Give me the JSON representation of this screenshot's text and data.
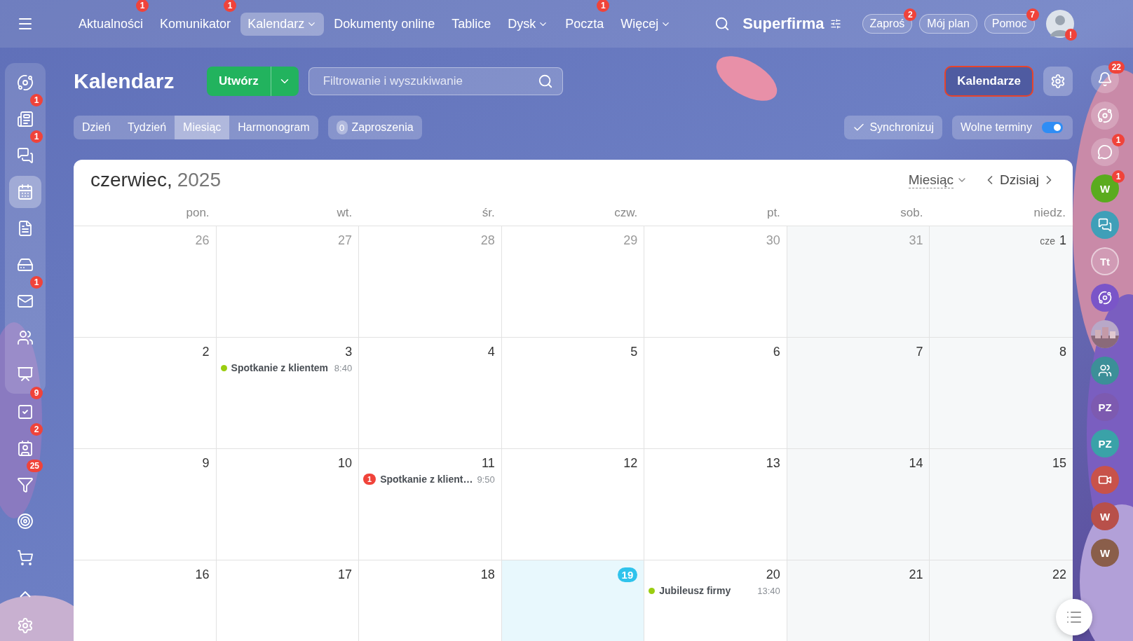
{
  "top_bar": {
    "nav": [
      {
        "label": "Aktualności",
        "badge": "1",
        "dropdown": false,
        "selected": false
      },
      {
        "label": "Komunikator",
        "badge": "1",
        "dropdown": false,
        "selected": false
      },
      {
        "label": "Kalendarz",
        "dropdown": true,
        "selected": true
      },
      {
        "label": "Dokumenty online",
        "dropdown": false,
        "selected": false
      },
      {
        "label": "Tablice",
        "dropdown": false,
        "selected": false
      },
      {
        "label": "Dysk",
        "dropdown": true,
        "selected": false
      },
      {
        "label": "Poczta",
        "badge": "1",
        "dropdown": false,
        "selected": false
      },
      {
        "label": "Więcej",
        "dropdown": true,
        "selected": false
      }
    ],
    "company": "Superfirma",
    "actions": [
      {
        "label": "Zaproś",
        "badge": "2"
      },
      {
        "label": "Mój plan"
      },
      {
        "label": "Pomoc",
        "badge": "7"
      }
    ],
    "avatar_alert": "!"
  },
  "left_sidebar": {
    "pinned": [
      {
        "kind": "flow",
        "selected": false
      },
      {
        "kind": "feed",
        "badge": "1",
        "selected": false
      },
      {
        "kind": "chat",
        "badge": "1",
        "selected": false
      },
      {
        "kind": "calendar",
        "selected": true
      },
      {
        "kind": "docs",
        "selected": false
      },
      {
        "kind": "drive",
        "selected": false
      },
      {
        "kind": "mail",
        "badge": "1",
        "selected": false
      },
      {
        "kind": "team",
        "selected": false
      },
      {
        "kind": "board",
        "selected": false
      }
    ],
    "items": [
      {
        "kind": "tasks",
        "badge": "9",
        "selected": false
      },
      {
        "kind": "contacts",
        "badge": "2",
        "selected": false
      },
      {
        "kind": "funnel",
        "badge": "25",
        "selected": false
      },
      {
        "kind": "target",
        "selected": false
      },
      {
        "kind": "shop",
        "selected": false
      },
      {
        "kind": "more",
        "selected": false
      }
    ]
  },
  "page": {
    "title": "Kalendarz",
    "create_button": "Utwórz",
    "search": {
      "placeholder": "Filtrowanie i wyszukiwanie"
    },
    "calendars_button": "Kalendarze",
    "views": [
      {
        "label": "Dzień",
        "selected": false
      },
      {
        "label": "Tydzień",
        "selected": false
      },
      {
        "label": "Miesiąc",
        "selected": true
      },
      {
        "label": "Harmonogram",
        "selected": false
      }
    ],
    "invitations": {
      "count": "0",
      "label": "Zaproszenia"
    },
    "sync_button": "Synchronizuj",
    "free_slots": {
      "label": "Wolne terminy",
      "on": true
    }
  },
  "calendar": {
    "month": "czerwiec,",
    "year": "2025",
    "view": "Miesiąc",
    "today_button": "Dzisiaj",
    "weekdays": [
      "pon.",
      "wt.",
      "śr.",
      "czw.",
      "pt.",
      "sob.",
      "niedz."
    ],
    "weeks": [
      [
        {
          "number": "26",
          "muted": true,
          "today": false
        },
        {
          "number": "27",
          "muted": true,
          "today": false
        },
        {
          "number": "28",
          "muted": true,
          "today": false
        },
        {
          "number": "29",
          "muted": true,
          "today": false
        },
        {
          "number": "30",
          "muted": true,
          "today": false
        },
        {
          "number": "31",
          "muted": true,
          "today": false
        },
        {
          "number": "1",
          "prefix": "cze",
          "muted": false,
          "today": false
        }
      ],
      [
        {
          "number": "2",
          "muted": false,
          "today": false
        },
        {
          "number": "3",
          "muted": false,
          "today": false,
          "events": [
            {
              "kind": "dot",
              "color": "#9acd10",
              "title": "Spotkanie z klientem",
              "time": "8:40"
            }
          ]
        },
        {
          "number": "4",
          "muted": false,
          "today": false
        },
        {
          "number": "5",
          "muted": false,
          "today": false
        },
        {
          "number": "6",
          "muted": false,
          "today": false
        },
        {
          "number": "7",
          "muted": false,
          "today": false
        },
        {
          "number": "8",
          "muted": false,
          "today": false
        }
      ],
      [
        {
          "number": "9",
          "muted": false,
          "today": false
        },
        {
          "number": "10",
          "muted": false,
          "today": false
        },
        {
          "number": "11",
          "muted": false,
          "today": false,
          "events": [
            {
              "kind": "count",
              "count": "1",
              "title": "Spotkanie z klient…",
              "time": "9:50"
            }
          ]
        },
        {
          "number": "12",
          "muted": false,
          "today": false
        },
        {
          "number": "13",
          "muted": false,
          "today": false
        },
        {
          "number": "14",
          "muted": false,
          "today": false
        },
        {
          "number": "15",
          "muted": false,
          "today": false
        }
      ],
      [
        {
          "number": "16",
          "muted": false,
          "today": false
        },
        {
          "number": "17",
          "muted": false,
          "today": false
        },
        {
          "number": "18",
          "muted": false,
          "today": false
        },
        {
          "number": "19",
          "muted": false,
          "today": true
        },
        {
          "number": "20",
          "muted": false,
          "today": false,
          "events": [
            {
              "kind": "dot",
              "color": "#9acd10",
              "title": "Jubileusz firmy",
              "time": "13:40"
            }
          ]
        },
        {
          "number": "21",
          "muted": false,
          "today": false
        },
        {
          "number": "22",
          "muted": false,
          "today": false
        }
      ]
    ]
  },
  "right_sidebar": [
    {
      "kind": "bell",
      "badge": "22"
    },
    {
      "kind": "orbit"
    },
    {
      "kind": "chat",
      "badge": "1"
    },
    {
      "kind": "avatar",
      "initials": "W",
      "color": "#5aab1e",
      "badge": "1"
    },
    {
      "kind": "chat_avatar",
      "color": "#3f9fb8"
    },
    {
      "kind": "avatar_outline",
      "initials": "Tt"
    },
    {
      "kind": "orbit_avatar",
      "color": "#7a55c8"
    },
    {
      "kind": "picture"
    },
    {
      "kind": "group_avatar",
      "color": "#3c8f98"
    },
    {
      "kind": "avatar",
      "initials": "PZ",
      "color": "#7d5ab0"
    },
    {
      "kind": "avatar",
      "initials": "PZ",
      "color": "#3aa2a8"
    },
    {
      "kind": "video_avatar",
      "color": "#c8524a"
    },
    {
      "kind": "avatar",
      "initials": "W",
      "color": "#b8504a"
    },
    {
      "kind": "avatar",
      "initials": "W",
      "color": "#8a5e4a"
    }
  ]
}
